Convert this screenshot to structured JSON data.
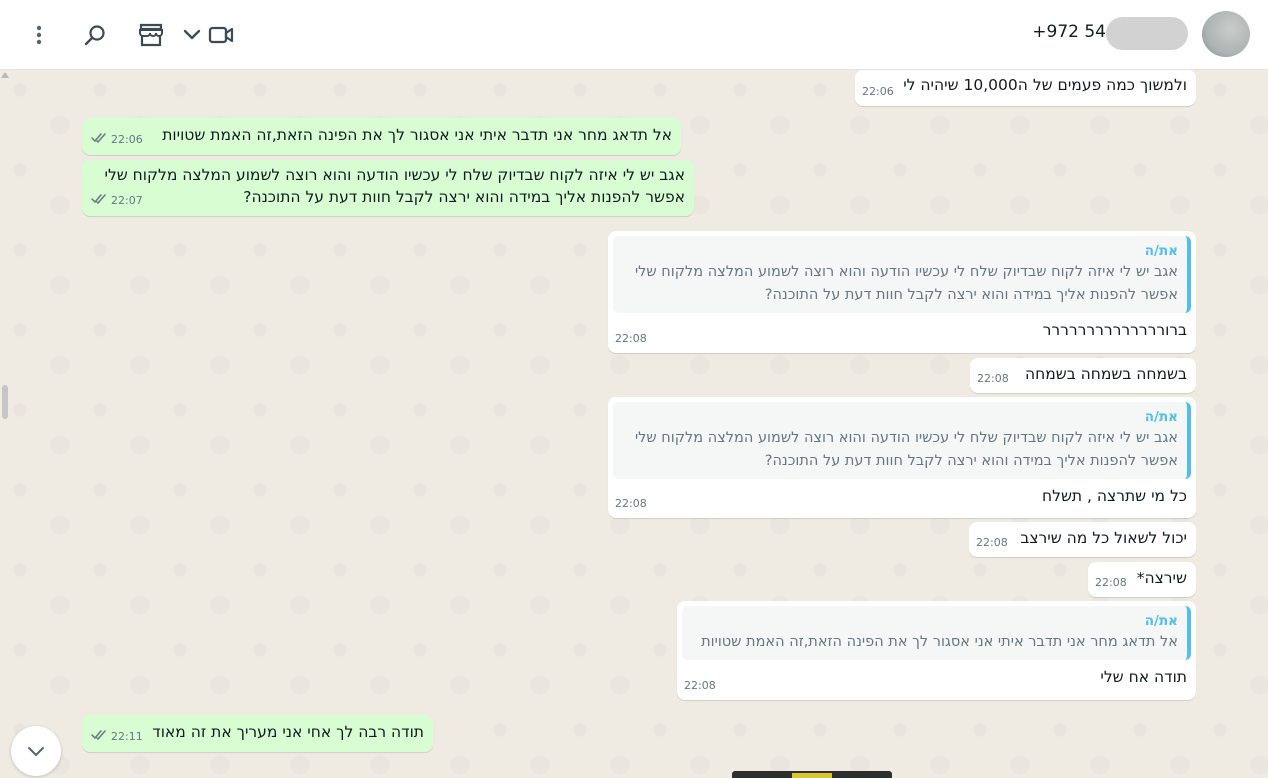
{
  "header": {
    "contact_name": "+972 54",
    "icons": [
      "menu-icon",
      "search-icon",
      "catalog-icon",
      "chevron-down-icon",
      "video-call-icon"
    ]
  },
  "messages": [
    {
      "side": "in",
      "text": "ולמשוך כמה פעמים של ה10,000 שיהיה לי",
      "time": "22:06"
    },
    {
      "side": "out",
      "text": "אל תדאג מחר אני תדבר איתי אני אסגור לך את הפינה הזאת,זה האמת שטויות",
      "time": "22:06"
    },
    {
      "side": "out",
      "text": "אגב יש לי איזה לקוח שבדיוק שלח לי עכשיו הודעה והוא רוצה לשמוע המלצה מלקוח שלי אפשר להפנות אליך במידה והוא ירצה לקבל חוות דעת על התוכנה?",
      "time": "22:07"
    },
    {
      "side": "in",
      "quote_author": "את/ה",
      "quote_text": "אגב יש לי איזה לקוח שבדיוק שלח לי עכשיו הודעה והוא רוצה לשמוע המלצה מלקוח שלי אפשר להפנות אליך במידה והוא ירצה לקבל חוות דעת על התוכנה?",
      "text": "ברורררררררררררררר",
      "time": "22:08"
    },
    {
      "side": "in",
      "text": "בשמחה בשמחה בשמחה",
      "time": "22:08"
    },
    {
      "side": "in",
      "quote_author": "את/ה",
      "quote_text": "אגב יש לי איזה לקוח שבדיוק שלח לי עכשיו הודעה והוא רוצה לשמוע המלצה מלקוח שלי אפשר להפנות אליך במידה והוא ירצה לקבל חוות דעת על התוכנה?",
      "text": "כל מי שתרצה , תשלח",
      "time": "22:08"
    },
    {
      "side": "in",
      "text": "יכול לשאול כל מה שירצב",
      "time": "22:08"
    },
    {
      "side": "in",
      "text": "שירצה*",
      "time": "22:08"
    },
    {
      "side": "in",
      "quote_author": "את/ה",
      "quote_text": "אל תדאג מחר אני תדבר איתי אני אסגור לך את הפינה הזאת,זה האמת שטויות",
      "text": "תודה אח שלי",
      "time": "22:08"
    },
    {
      "side": "out",
      "text": "תודה רבה לך אחי אני מעריך את זה מאוד",
      "time": "22:11"
    }
  ]
}
